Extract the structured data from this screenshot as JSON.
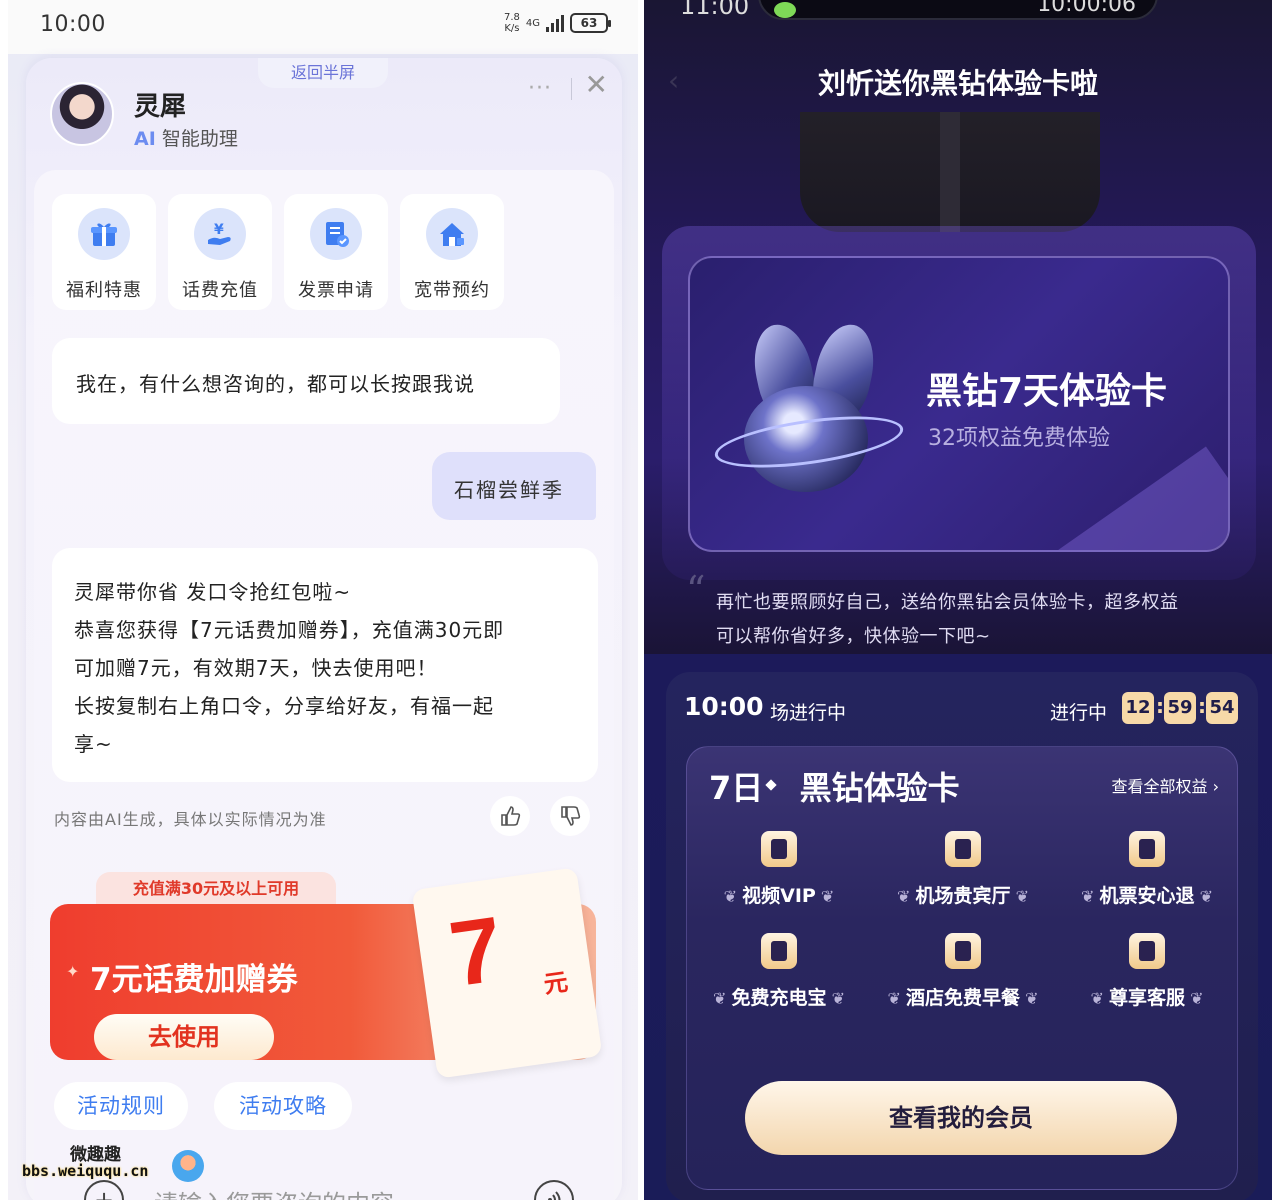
{
  "left": {
    "status_bar": {
      "time": "10:00",
      "net_speed_value": "7.8",
      "net_speed_unit": "K/s",
      "network": "4G",
      "battery": "63"
    },
    "sheet": {
      "return_label": "返回半屏",
      "more_label": "···",
      "close_label": "✕"
    },
    "assistant": {
      "name": "灵犀",
      "sub_prefix": "AI",
      "sub_text": "智能助理"
    },
    "quick_actions": [
      {
        "label": "福利特惠",
        "icon": "gift-icon"
      },
      {
        "label": "话费充值",
        "icon": "yuan-hand-icon"
      },
      {
        "label": "发票申请",
        "icon": "invoice-icon"
      },
      {
        "label": "宽带预约",
        "icon": "broadband-home-icon"
      }
    ],
    "chat": {
      "greeting": "我在，有什么想咨询的，都可以长按跟我说",
      "user_message": "石榴尝鲜季",
      "reply_lines": [
        "灵犀带你省 发口令抢红包啦~",
        "恭喜您获得【7元话费加赠券】，充值满30元即",
        "可加赠7元，有效期7天，快去使用吧！",
        "长按复制右上角口令，分享给好友，有福一起",
        "享~"
      ],
      "disclaimer": "内容由AI生成，具体以实际情况为准"
    },
    "coupon": {
      "condition": "充值满30元及以上可用",
      "title": "7元话费加赠券",
      "button": "去使用",
      "amount": "7",
      "unit": "元",
      "accent": "#ef3d2e"
    },
    "links": {
      "rules": "活动规则",
      "strategy": "活动攻略"
    },
    "input": {
      "placeholder": "请输入您要咨询的内容"
    },
    "watermark": {
      "cn": "微趣趣",
      "url": "bbs.weiququ.cn"
    }
  },
  "right": {
    "status_bar": {
      "time": "11:00",
      "island_time": "10:00:06"
    },
    "title": "刘忻送你黑钻体验卡啦",
    "card": {
      "title": "黑钻7天体验卡",
      "subtitle": "32项权益免费体验"
    },
    "quote_lines": [
      "再忙也要照顾好自己，送给你黑钻会员体验卡，超多权益",
      "可以帮你省好多，快体验一下吧~"
    ],
    "session": {
      "time": "10:00",
      "status": "场进行中",
      "countdown_label": "进行中",
      "countdown": [
        "12",
        "59",
        "54"
      ]
    },
    "benefits_panel": {
      "title_days": "7日",
      "title_text": "黑钻体验卡",
      "view_all": "查看全部权益 ›",
      "items": [
        {
          "label": "视频VIP",
          "icon": "video-play-icon"
        },
        {
          "label": "机场贵宾厅",
          "icon": "lounge-sofa-icon"
        },
        {
          "label": "机票安心退",
          "icon": "ticket-refund-icon"
        },
        {
          "label": "免费充电宝",
          "icon": "power-bank-icon"
        },
        {
          "label": "酒店免费早餐",
          "icon": "breakfast-icon"
        },
        {
          "label": "尊享客服",
          "icon": "headset-icon"
        }
      ],
      "button": "查看我的会员"
    },
    "accent": "#f7d9a8"
  }
}
